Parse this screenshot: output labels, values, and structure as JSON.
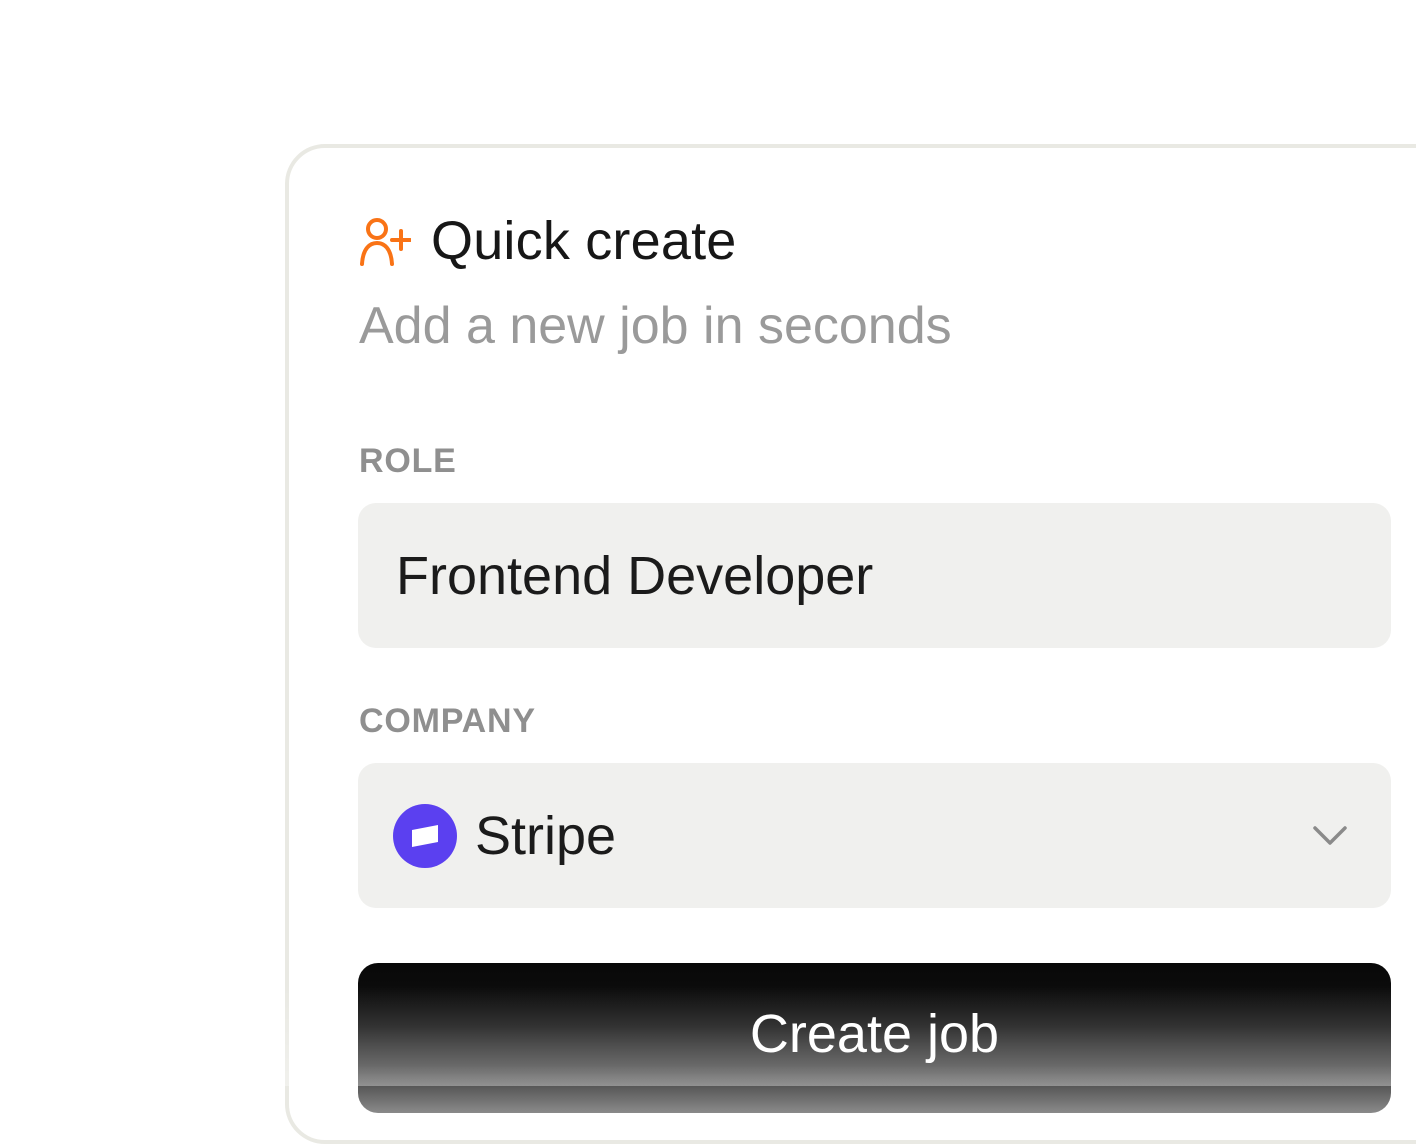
{
  "quick_create": {
    "icon": "user-plus-icon",
    "title": "Quick create",
    "subtitle": "Add a new job in seconds"
  },
  "form": {
    "role": {
      "label": "ROLE",
      "value": "Frontend Developer"
    },
    "company": {
      "label": "COMPANY",
      "value": "Stripe",
      "logo_icon": "stripe-logo-icon",
      "dropdown_icon": "chevron-down-icon"
    },
    "submit_label": "Create job"
  },
  "colors": {
    "accent": "#f97316",
    "company_logo": "#5b40f0",
    "muted_text": "#9a9a9a",
    "field_background": "#f0f0ee",
    "button_background": "#080808"
  }
}
